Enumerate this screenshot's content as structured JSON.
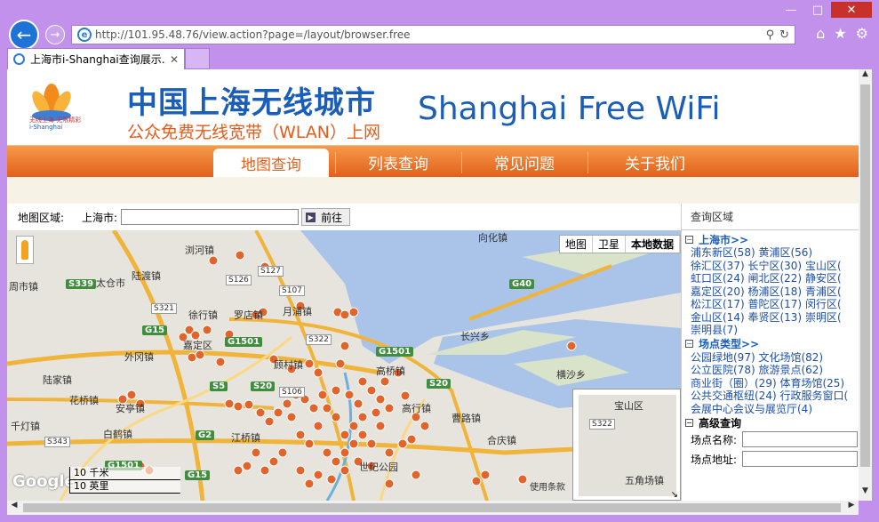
{
  "browser": {
    "url": "http://101.95.48.76/view.action?page=/layout/browser.free",
    "tab_title": "上海市i-Shanghai查询展示...",
    "back_icon": "back-arrow-icon",
    "forward_icon": "forward-arrow-icon",
    "window_controls": [
      "minimize-icon",
      "maximize-icon",
      "close-icon"
    ],
    "toolbar_icons": [
      "home-icon",
      "star-icon",
      "gear-icon"
    ]
  },
  "header": {
    "title_cn": "中国上海无线城市",
    "subtitle_cn": "公众免费无线宽带（WLAN）上网",
    "title_en": "Shanghai Free WiFi",
    "logo_text": "无线上海 无限精彩",
    "logo_sub": "i-Shanghai"
  },
  "menu": [
    "地图查询",
    "列表查询",
    "常见问题",
    "关于我们"
  ],
  "toolbar": {
    "area_label": "地图区域:",
    "city_label": "上海市:",
    "input_value": "",
    "go_label": "前往"
  },
  "map": {
    "types": [
      "地图",
      "卫星",
      "本地数据"
    ],
    "scale": [
      "10 千米",
      "10 英里"
    ],
    "google": "Google",
    "terms": "使用条款",
    "place_labels": [
      "浏河镇",
      "向化镇",
      "陆渡镇",
      "周市镇",
      "太仓市",
      "徐行镇",
      "罗店镇",
      "月浦镇",
      "嘉定区",
      "外冈镇",
      "长兴乡",
      "陆家镇",
      "顾村镇",
      "高桥镇",
      "横沙乡",
      "花桥镇",
      "安亭镇",
      "高行镇",
      "曹路镇",
      "千灯镇",
      "白鹤镇",
      "江桥镇",
      "合庆镇",
      "世纪公园",
      "宝山区",
      "五角场镇"
    ],
    "highway_shields": [
      "S339",
      "S126",
      "S127",
      "S107",
      "G40",
      "S321",
      "G15",
      "G1501",
      "S322",
      "S5",
      "S20",
      "S106",
      "G2",
      "S343",
      "G15",
      "G1501",
      "G1501",
      "S20"
    ],
    "overview_labels": [
      "宝山区",
      "S322",
      "五角场镇"
    ]
  },
  "sidebar": {
    "title": "查询区域",
    "section_city": "上海市>>",
    "districts": [
      "浦东新区(58)",
      "黄浦区(56)",
      "徐汇区(37)",
      "长宁区(30)",
      "宝山区(",
      "虹口区(24)",
      "闸北区(22)",
      "静安区(",
      "嘉定区(20)",
      "杨浦区(18)",
      "青浦区(",
      "松江区(17)",
      "普陀区(17)",
      "闵行区(",
      "金山区(14)",
      "奉贤区(13)",
      "崇明区(",
      "崇明县(7)"
    ],
    "section_type": "场点类型>>",
    "types": [
      "公园绿地(97)",
      "文化场馆(82)",
      "公立医院(78)",
      "旅游景点(62)",
      "商业街（圈）(29)",
      "体育场馆(25)",
      "公共交通枢纽(24)",
      "行政服务窗口(",
      "会展中心会议与展览厅(4)"
    ],
    "section_adv": "高级查询",
    "field_name": "场点名称:",
    "field_addr": "场点地址:"
  }
}
